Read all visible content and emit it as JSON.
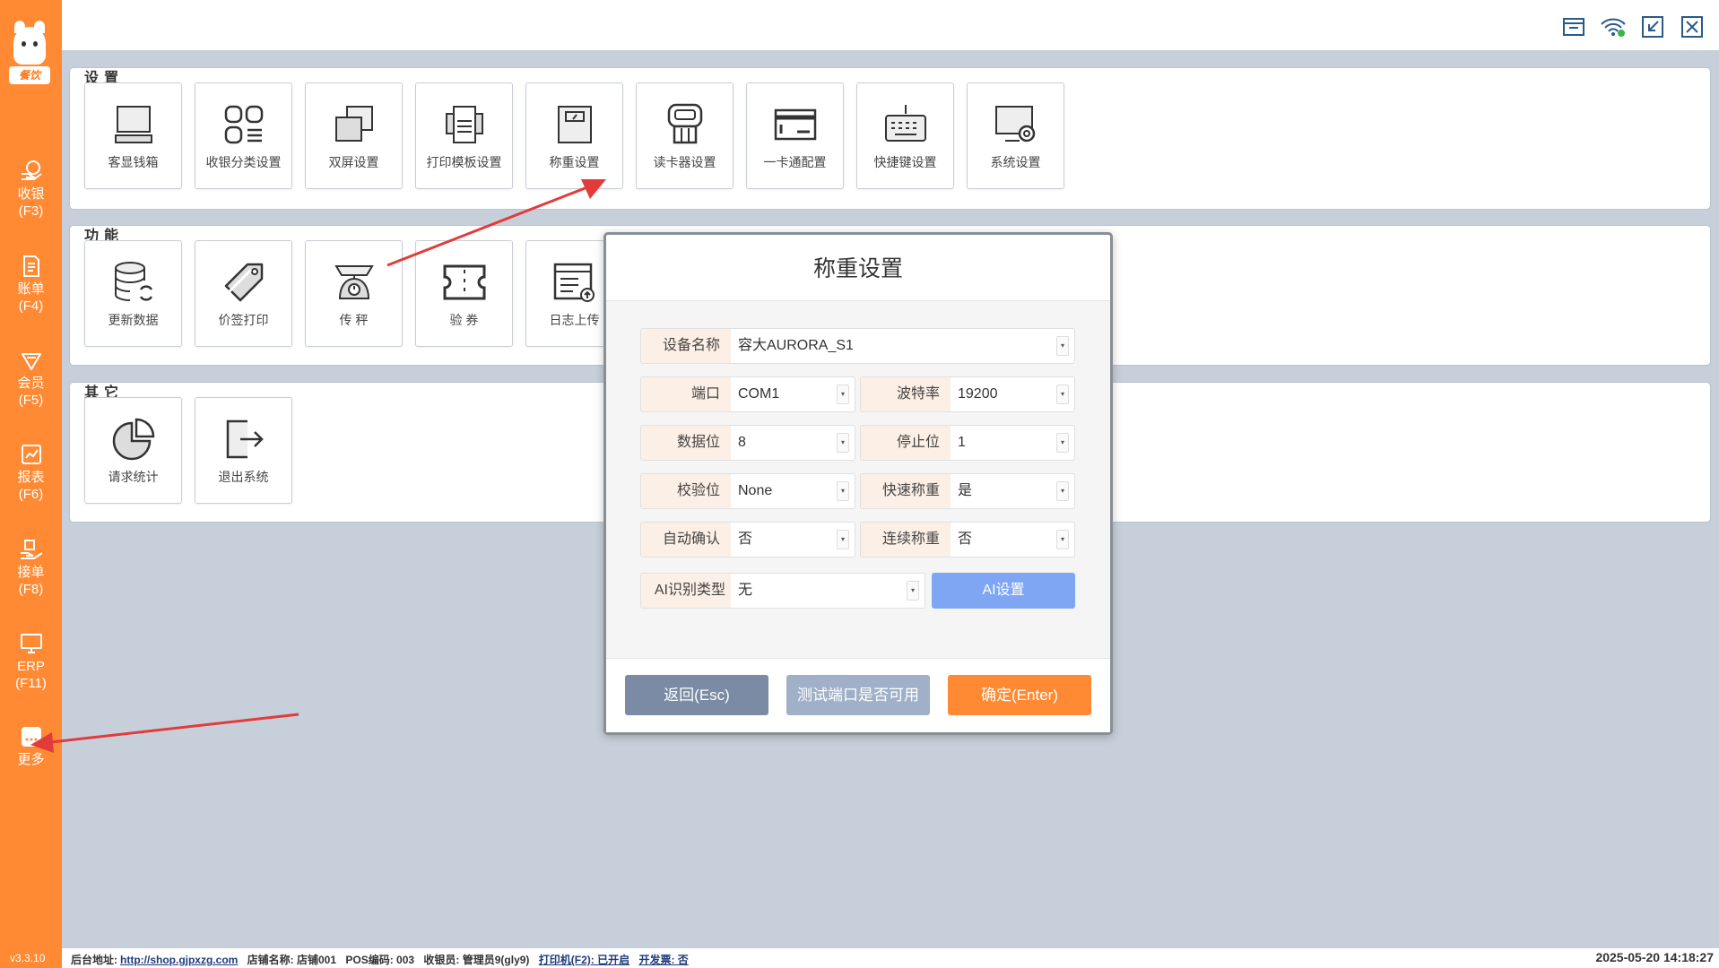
{
  "app": {
    "logo_text": "餐饮",
    "version": "v3.3.10"
  },
  "sidebar": {
    "items": [
      {
        "label": "收银",
        "key": "(F3)",
        "icon": "cashier-icon"
      },
      {
        "label": "账单",
        "key": "(F4)",
        "icon": "bill-icon"
      },
      {
        "label": "会员",
        "key": "(F5)",
        "icon": "member-icon"
      },
      {
        "label": "报表",
        "key": "(F6)",
        "icon": "report-icon"
      },
      {
        "label": "接单",
        "key": "(F8)",
        "icon": "order-icon"
      },
      {
        "label": "ERP",
        "key": "(F11)",
        "icon": "erp-icon"
      },
      {
        "label": "更多",
        "key": "",
        "icon": "more-icon"
      }
    ]
  },
  "topbar_icons": [
    "window-icon",
    "wifi-icon",
    "minimize-icon",
    "close-icon"
  ],
  "sections": {
    "settings": {
      "title": "设置",
      "tiles": [
        "客显钱箱",
        "收银分类设置",
        "双屏设置",
        "打印模板设置",
        "称重设置",
        "读卡器设置",
        "一卡通配置",
        "快捷键设置",
        "系统设置"
      ]
    },
    "functions": {
      "title": "功能",
      "tiles": [
        "更新数据",
        "价签打印",
        "传 秤",
        "验 券",
        "日志上传"
      ]
    },
    "others": {
      "title": "其它",
      "tiles": [
        "请求统计",
        "退出系统"
      ]
    }
  },
  "dialog": {
    "title": "称重设置",
    "fields": {
      "device_name": {
        "label": "设备名称",
        "value": "容大AURORA_S1"
      },
      "port": {
        "label": "端口",
        "value": "COM1"
      },
      "baud": {
        "label": "波特率",
        "value": "19200"
      },
      "data_bits": {
        "label": "数据位",
        "value": "8"
      },
      "stop_bits": {
        "label": "停止位",
        "value": "1"
      },
      "parity": {
        "label": "校验位",
        "value": "None"
      },
      "quick_weigh": {
        "label": "快速称重",
        "value": "是"
      },
      "auto_confirm": {
        "label": "自动确认",
        "value": "否"
      },
      "continuous_weigh": {
        "label": "连续称重",
        "value": "否"
      },
      "ai_type": {
        "label": "AI识别类型",
        "value": "无"
      }
    },
    "ai_button": "AI设置",
    "buttons": {
      "back": "返回(Esc)",
      "test": "测试端口是否可用",
      "confirm": "确定(Enter)"
    }
  },
  "statusbar": {
    "backend_label": "后台地址:",
    "backend_url": "http://shop.gjpxzg.com",
    "store": "店铺名称: 店铺001",
    "pos": "POS编码: 003",
    "cashier": "收银员: 管理员9(gly9)",
    "printer": "打印机(F2): 已开启",
    "invoice": "开发票: 否",
    "datetime": "2025-05-20 14:18:27"
  },
  "colors": {
    "sidebar": "#ff8a33",
    "confirm": "#ff8a33",
    "back": "#7a8ba3",
    "test": "#9fb0c8",
    "ai": "#7ea6f3",
    "arrow": "#e23b3b"
  }
}
